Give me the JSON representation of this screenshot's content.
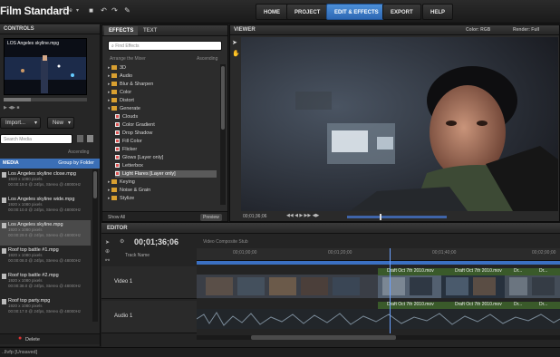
{
  "app": {
    "title": "Film Standard",
    "menu_file": "File"
  },
  "nav": {
    "home": "HOME",
    "project": "PROJECT",
    "edit_effects": "EDIT & EFFECTS",
    "export": "EXPORT",
    "help": "HELP"
  },
  "controls": {
    "header": "CONTROLS",
    "preview_filename": "LOS Angeles skyline.mpg",
    "import_label": "Import...",
    "new_label": "New",
    "search_placeholder": "Search Media",
    "sort_label": "Ascending",
    "media_header": "MEDIA",
    "group_by": "Group by Folder",
    "items": [
      {
        "title": "Los Angeles skyline close.mpg",
        "res": "1920 x 1080 pixels",
        "info": "00:00:19.0 @ 24fps, Stereo @ 48000Hz"
      },
      {
        "title": "Los Angeles skyline wide.mpg",
        "res": "1920 x 1080 pixels",
        "info": "00:00:10.0 @ 24fps, Stereo @ 48000Hz"
      },
      {
        "title": "Los Angeles skyline.mpg",
        "res": "1920 x 1080 pixels",
        "info": "00:00:29.0 @ 24fps, Stereo @ 48000Hz"
      },
      {
        "title": "Roof top battle #1.mpg",
        "res": "1920 x 1080 pixels",
        "info": "00:00:08.0 @ 24fps, Stereo @ 48000Hz"
      },
      {
        "title": "Roof top battle #2.mpg",
        "res": "1920 x 1080 pixels",
        "info": "00:00:38.0 @ 24fps, Stereo @ 48000Hz"
      },
      {
        "title": "Roof top party.mpg",
        "res": "1920 x 1080 pixels",
        "info": "00:00:17.0 @ 24fps, Stereo @ 48000Hz"
      }
    ],
    "delete_label": "Delete"
  },
  "effects": {
    "tab_effects": "EFFECTS",
    "tab_text": "TEXT",
    "search_placeholder": "Find Effects",
    "col_name": "Arrange the Mixer",
    "col_sort": "Ascending",
    "tree": [
      {
        "label": "3D",
        "type": "folder"
      },
      {
        "label": "Audio",
        "type": "folder"
      },
      {
        "label": "Blur & Sharpen",
        "type": "folder"
      },
      {
        "label": "Color",
        "type": "folder"
      },
      {
        "label": "Distort",
        "type": "folder"
      },
      {
        "label": "Generate",
        "type": "folder-open"
      },
      {
        "label": "Clouds",
        "type": "effect"
      },
      {
        "label": "Color Gradient",
        "type": "effect"
      },
      {
        "label": "Drop Shadow",
        "type": "effect"
      },
      {
        "label": "Fill Color",
        "type": "effect"
      },
      {
        "label": "Flicker",
        "type": "effect"
      },
      {
        "label": "Glows [Layer only]",
        "type": "effect"
      },
      {
        "label": "Letterbox",
        "type": "effect"
      },
      {
        "label": "Light Flares [Layer only]",
        "type": "effect-selected"
      },
      {
        "label": "Keying",
        "type": "folder"
      },
      {
        "label": "Noise & Grain",
        "type": "folder"
      },
      {
        "label": "Stylize",
        "type": "folder"
      }
    ],
    "show_label": "Show All",
    "preview_label": "Preview"
  },
  "viewer": {
    "header": "VIEWER",
    "color_label": "Color: RGB",
    "render_label": "Render: Full",
    "timecode": "00;01;36;06"
  },
  "editor": {
    "header": "EDITOR",
    "timecode": "00;01;36;06",
    "composite_label": "Video Composite Stub",
    "track_name_label": "Track Name",
    "video_track": "Video 1",
    "audio_track": "Audio 1",
    "clip_draft": "Draft Oct 7th 2010.mov",
    "clip_short": "Dr...",
    "ruler": [
      "00;01;00;00",
      "00;01;20;00",
      "00;01;40;00",
      "00;02;00;00"
    ]
  },
  "status": {
    "text": "..llvfp [Unsaved]"
  }
}
